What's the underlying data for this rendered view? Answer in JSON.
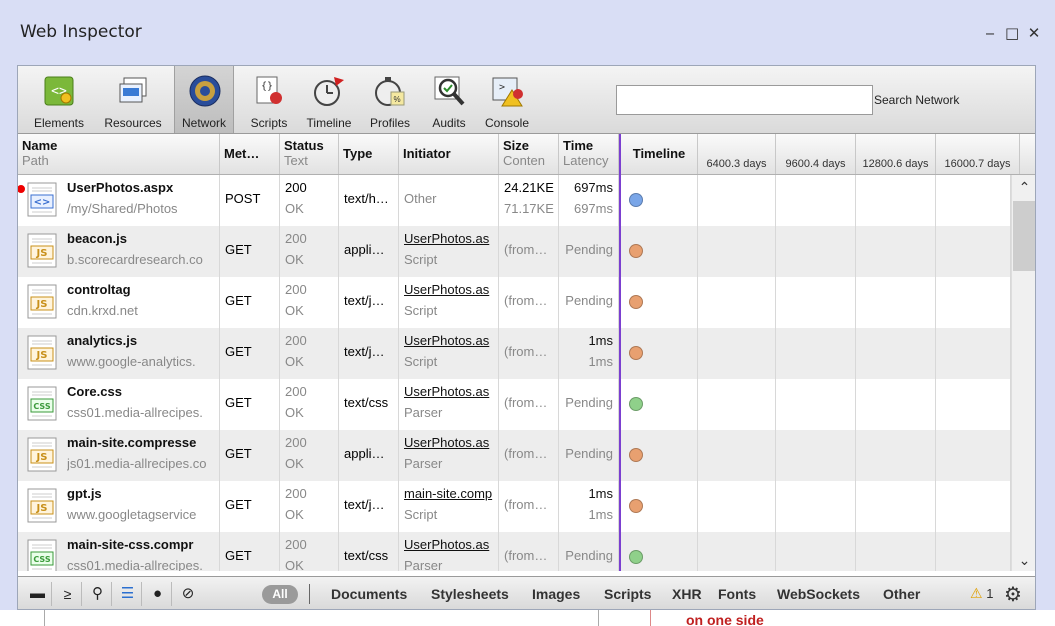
{
  "window": {
    "title": "Web Inspector",
    "controls": {
      "minimize": "‒",
      "maximize": "□",
      "close": "✕"
    }
  },
  "toolbar": {
    "tools": [
      {
        "label": "Elements",
        "icon": "elements-icon"
      },
      {
        "label": "Resources",
        "icon": "resources-icon"
      },
      {
        "label": "Network",
        "icon": "network-icon",
        "selected": true
      },
      {
        "label": "Scripts",
        "icon": "scripts-icon"
      },
      {
        "label": "Timeline",
        "icon": "timeline-icon"
      },
      {
        "label": "Profiles",
        "icon": "profiles-icon"
      },
      {
        "label": "Audits",
        "icon": "audits-icon"
      },
      {
        "label": "Console",
        "icon": "console-icon"
      }
    ],
    "search": {
      "value": "",
      "label": "Search Network"
    }
  },
  "columns": {
    "name": {
      "title": "Name",
      "sub": "Path"
    },
    "method": {
      "title": "Met…"
    },
    "status": {
      "title": "Status",
      "sub": "Text"
    },
    "type": {
      "title": "Type"
    },
    "initiator": {
      "title": "Initiator"
    },
    "size": {
      "title": "Size",
      "sub": "Conten"
    },
    "time": {
      "title": "Time",
      "sub": "Latency"
    },
    "timeline": {
      "title": "Timeline"
    },
    "timeline_ticks": [
      "6400.3 days",
      "9600.4 days",
      "12800.6 days",
      "16000.7 days"
    ]
  },
  "rows": [
    {
      "name": "UserPhotos.aspx",
      "path": "/my/Shared/Photos",
      "icon": "html",
      "error": true,
      "method": "POST",
      "status": "200",
      "status_text": "OK",
      "type": "text/h…",
      "initiator": "Other",
      "initiator_sub": "",
      "size": "24.21KE",
      "size_sub": "71.17KE",
      "time": "697ms",
      "latency": "697ms",
      "dot": "#7aa6e8"
    },
    {
      "name": "beacon.js",
      "path": "b.scorecardresearch.co",
      "icon": "js",
      "method": "GET",
      "status": "200",
      "status_text": "OK",
      "type": "appli…",
      "initiator": "UserPhotos.as",
      "initiator_sub": "Script",
      "size": "(from…",
      "size_sub": "",
      "time": "Pending",
      "latency": "",
      "dot": "#e8a070"
    },
    {
      "name": "controltag",
      "path": "cdn.krxd.net",
      "icon": "js",
      "method": "GET",
      "status": "200",
      "status_text": "OK",
      "type": "text/j…",
      "initiator": "UserPhotos.as",
      "initiator_sub": "Script",
      "size": "(from…",
      "size_sub": "",
      "time": "Pending",
      "latency": "",
      "dot": "#e8a070"
    },
    {
      "name": "analytics.js",
      "path": "www.google-analytics.",
      "icon": "js",
      "method": "GET",
      "status": "200",
      "status_text": "OK",
      "type": "text/j…",
      "initiator": "UserPhotos.as",
      "initiator_sub": "Script",
      "size": "(from…",
      "size_sub": "",
      "time": "1ms",
      "latency": "1ms",
      "dot": "#e8a070"
    },
    {
      "name": "Core.css",
      "path": "css01.media-allrecipes.",
      "icon": "css",
      "method": "GET",
      "status": "200",
      "status_text": "OK",
      "type": "text/css",
      "initiator": "UserPhotos.as",
      "initiator_sub": "Parser",
      "size": "(from…",
      "size_sub": "",
      "time": "Pending",
      "latency": "",
      "dot": "#8fd08a"
    },
    {
      "name": "main-site.compresse",
      "path": "js01.media-allrecipes.co",
      "icon": "js",
      "method": "GET",
      "status": "200",
      "status_text": "OK",
      "type": "appli…",
      "initiator": "UserPhotos.as",
      "initiator_sub": "Parser",
      "size": "(from…",
      "size_sub": "",
      "time": "Pending",
      "latency": "",
      "dot": "#e8a070"
    },
    {
      "name": "gpt.js",
      "path": "www.googletagservice",
      "icon": "js",
      "method": "GET",
      "status": "200",
      "status_text": "OK",
      "type": "text/j…",
      "initiator": "main-site.comp",
      "initiator_sub": "Script",
      "size": "(from…",
      "size_sub": "",
      "time": "1ms",
      "latency": "1ms",
      "dot": "#e8a070"
    },
    {
      "name": "main-site-css.compr",
      "path": "css01.media-allrecipes.",
      "icon": "css",
      "method": "GET",
      "status": "200",
      "status_text": "OK",
      "type": "text/css",
      "initiator": "UserPhotos.as",
      "initiator_sub": "Parser",
      "size": "(from…",
      "size_sub": "",
      "time": "Pending",
      "latency": "",
      "dot": "#8fd08a"
    }
  ],
  "statusbar": {
    "all_label": "All",
    "filters": [
      "Documents",
      "Stylesheets",
      "Images",
      "Scripts",
      "XHR",
      "Fonts",
      "WebSockets",
      "Other"
    ],
    "warning_count": "1"
  },
  "page_below": {
    "text": "on one side"
  }
}
